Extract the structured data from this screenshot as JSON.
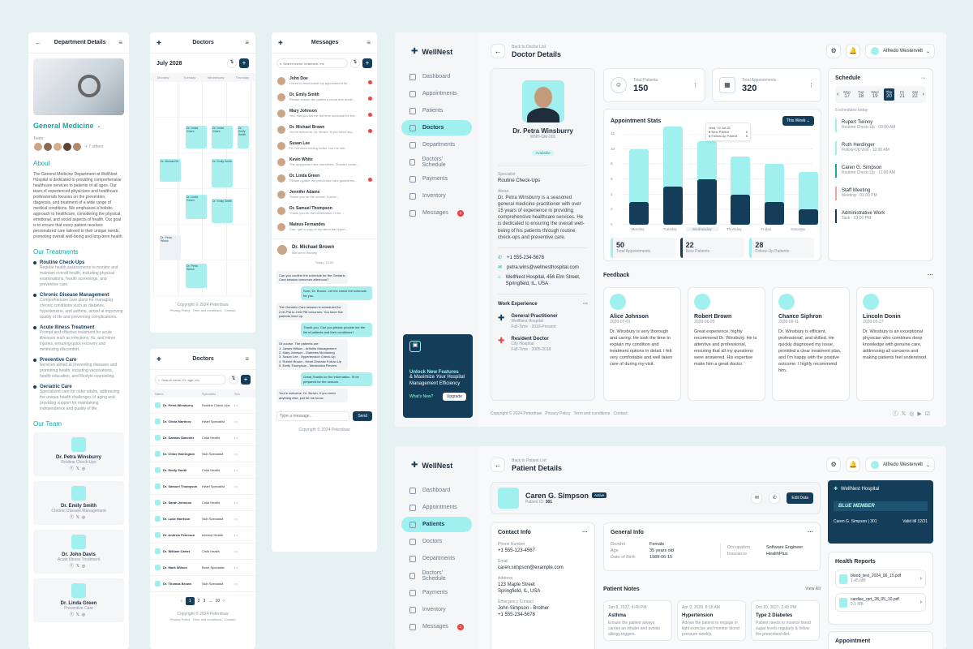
{
  "dept": {
    "title": "Department Details",
    "name": "General Medicine",
    "team_label": "Team",
    "others": "+ 7 others",
    "about_h": "About",
    "about": "The General Medicine Department at WellNest Hospital is dedicated to providing comprehensive healthcare services to patients of all ages. Our team of experienced physicians and healthcare professionals focuses on the prevention, diagnosis, and treatment of a wide range of medical conditions. We emphasize a holistic approach to healthcare, considering the physical, emotional, and social aspects of health. Our goal is to ensure that every patient receives personalized care tailored to their unique needs, promoting overall well-being and long-term health.",
    "treat_h": "Our Treatments",
    "treatments": [
      {
        "t": "Routine Check-Ups",
        "d": "Regular health assessments to monitor and maintain overall health, including physical examinations, health screenings, and preventive care."
      },
      {
        "t": "Chronic Disease Management",
        "d": "Comprehensive care plans for managing chronic conditions such as diabetes, hypertension, and asthma, aimed at improving quality of life and preventing complications."
      },
      {
        "t": "Acute Illness Treatment",
        "d": "Prompt and effective treatment for acute illnesses such as infections, flu, and minor injuries, ensuring quick recovery and minimizing discomfort."
      },
      {
        "t": "Preventive Care",
        "d": "Services aimed at preventing diseases and promoting health, including vaccinations, health education, and lifestyle counseling."
      },
      {
        "t": "Geriatric Care",
        "d": "Specialized care for older adults, addressing the unique health challenges of aging and providing support for maintaining independence and quality of life."
      }
    ],
    "team_h": "Our Team",
    "team": [
      {
        "n": "Dr. Petra Winsburry",
        "r": "Routine Check-Ups"
      },
      {
        "n": "Dr. Emily Smith",
        "r": "Chronic Disease Management"
      },
      {
        "n": "Dr. John Davis",
        "r": "Acute Illness Treatment"
      },
      {
        "n": "Dr. Linda Green",
        "r": "Preventive Care"
      }
    ]
  },
  "cal": {
    "title": "Doctors",
    "month": "July 2028",
    "days": [
      "Monday",
      "Tuesday",
      "Wednesday",
      "Thursday"
    ],
    "copy": "Copyright © 2024 Peterdraw",
    "links": [
      "Privacy Policy",
      "Term and conditions",
      "Contact"
    ],
    "events": [
      "Dr. Linda Green",
      "Dr. Linda Green",
      "Dr. Emily Smith",
      "Dr. Michael Br",
      "Dr. Emily Smith",
      "Dr. Linda Green",
      "Dr. Emily Smith",
      "Dr. Petra Winsb",
      "Dr. Petra Winsb"
    ]
  },
  "docs": {
    "title": "Doctors",
    "search": "Search name, ID, age, etc",
    "cols": [
      "Name",
      "Specialist",
      "Sch"
    ],
    "rows": [
      [
        "Dr. Petra Winsburry",
        "Routine Check-Ups"
      ],
      [
        "Dr. Olivia Martinez",
        "Heart Specialist"
      ],
      [
        "Dr. Damian Sanchez",
        "Child Health"
      ],
      [
        "Dr. Chloe Harrington",
        "Skin Specialist"
      ],
      [
        "Dr. Emily Smith",
        "Child Health"
      ],
      [
        "Dr. Samuel Thompson",
        "Heart Specialist"
      ],
      [
        "Dr. Sarah Johnson",
        "Child Health"
      ],
      [
        "Dr. Luke Harrison",
        "Skin Specialist"
      ],
      [
        "Dr. Andrew Peterson",
        "Internal Health"
      ],
      [
        "Dr. William Carter",
        "Child Health"
      ],
      [
        "Dr. Mark Wilson",
        "Bone Specialist"
      ],
      [
        "Dr. Thomas Brown",
        "Skin Specialist"
      ]
    ],
    "pages": [
      "1",
      "2",
      "3",
      "...",
      "10"
    ],
    "copy": "Copyright © 2024 Peterdraw",
    "links": [
      "Privacy Policy",
      "Term and conditions",
      "Contact"
    ]
  },
  "msg": {
    "title": "Messages",
    "search": "Search name, treatment, etc",
    "list": [
      {
        "n": "John Doe",
        "m": "I need to reschedule my appointment for..."
      },
      {
        "n": "Dr. Emily Smith",
        "m": "Please ensure the patient's blood test result..."
      },
      {
        "n": "Mary Johnson",
        "m": "Yes, can you tell me the time schedule for the..."
      },
      {
        "n": "Dr. Michael Brown",
        "m": "You're welcome, Dr. Brown. If you need any..."
      },
      {
        "n": "Susan Lee",
        "m": "Hi, I've been feeling better, but I've still..."
      },
      {
        "n": "Kevin White",
        "m": "The symptoms have worsened. Should I come..."
      },
      {
        "n": "Dr. Linda Green",
        "m": "Please update the preventive care guidelines..."
      },
      {
        "n": "Jennifer Adams",
        "m": "Thank you for the advice, Doctor..."
      },
      {
        "n": "Dr. Samuel Thompson",
        "m": "Thank you for the information. I'll be..."
      },
      {
        "n": "Mateus Fernandes",
        "m": "Can I get a copy of my latest lab report..."
      }
    ],
    "chat_with": "Dr. Michael Brown",
    "last_seen": "last seen recently",
    "today": "Today, 10:00",
    "bubbles": [
      "Can you confirm the schedule for the Geriatric Care session tomorrow afternoon?",
      "Sure, Dr. Brown. Let me check the schedule for you.",
      "The Geriatric Care session is scheduled for 2:00 PM to 4:00 PM tomorrow. You have five patients lined up.",
      "Thank you. Can you please provide me the list of patients and their conditions?",
      "Of course. The patients are:\n1. James Wilson - Arthritis Management\n2. Mary Johnson - Diabetes Monitoring\n3. Susan Lee - Hypertension Check-Up\n4. Robert Brown - Heart Disease Follow-Up\n5. Emily Thompson - Medication Review",
      "Great, thanks for the information. I'll be prepared for the session.",
      "You're welcome, Dr. Brown. If you need anything else, just let me know."
    ],
    "placeholder": "Type a message...",
    "send": "Send",
    "copy": "Copyright © 2024 Peterdraw"
  },
  "app": {
    "brand": "WellNest",
    "user": "Alfredo Westervelt",
    "nav": [
      "Dashboard",
      "Appointments",
      "Patients",
      "Doctors",
      "Departments",
      "Doctors' Schedule",
      "Payments",
      "Inventory",
      "Messages"
    ],
    "msg_badge": "2",
    "promo_title": "Unlock New Features",
    "promo_text": "& Maximize Your Hospital Management Efficiency",
    "promo_link": "What's New?",
    "promo_btn": "Upgrade"
  },
  "doctor": {
    "back": "Back to Doctor List",
    "title": "Doctor Details",
    "name": "Dr. Petra Winsburry",
    "id": "WNH-GM-001",
    "status": "Available",
    "spec_l": "Specialist",
    "spec": "Routine Check-Ups",
    "about_l": "About",
    "about": "Dr. Petra Winsburry is a seasoned general medicine practitioner with over 15 years of experience in providing comprehensive healthcare services. He is dedicated to ensuring the overall well-being of his patients through routine check-ups and preventive care.",
    "phone": "+1 555-234-5678",
    "email": "petra.wins@wellnesthospital.com",
    "addr": "WellNest Hospital, 456 Elm Street, Springfield, IL, USA",
    "work_h": "Work Experience",
    "work": [
      {
        "t": "General Practitioner",
        "p": "WellNest Hospital",
        "y": "Full-Time  ·  2018-Present"
      },
      {
        "t": "Resident Doctor",
        "p": "City Hospital",
        "y": "Full-Time  ·  2005-2018"
      }
    ],
    "tp_l": "Total Patients",
    "tp": "150",
    "ta_l": "Total Appointments",
    "ta": "320",
    "stats_h": "Appointment Stats",
    "filter": "This Week",
    "tip_date": "Wed, 10 Jul 28",
    "tip_new": "New Patient",
    "tip_new_v": "6",
    "tip_fu": "Follow-Up Patient",
    "tip_fu_v": "5",
    "sum": [
      {
        "v": "50",
        "l": "Total Appointments"
      },
      {
        "v": "22",
        "l": "New Patients"
      },
      {
        "v": "28",
        "l": "Follow-Up Patients"
      }
    ],
    "fb_h": "Feedback",
    "feedback": [
      {
        "n": "Alice Johnson",
        "d": "2028-07-01",
        "t": "Dr. Winsbury is very thorough and caring. He took the time to explain my condition and treatment options in detail. I felt very comfortable and well taken care of during my visit."
      },
      {
        "n": "Robert Brown",
        "d": "2028-06-25",
        "t": "Great experience, highly recommend Dr. Winsbury. He is attentive and professional, ensuring that all my questions were answered. His expertise make him a great doctor."
      },
      {
        "n": "Chance Siphron",
        "d": "2028-06-11",
        "t": "Dr. Winsbury is efficient, professional, and skilled. He quickly diagnosed my issue, provided a clear treatment plan, and I'm happy with the positive outcome. I highly recommend him."
      },
      {
        "n": "Lincoln Donin",
        "d": "2028-05-27",
        "t": "Dr. Winsbury is an exceptional physician who combines deep knowledge with genuine care, addressing all concerns and making patients feel understood."
      }
    ],
    "sched_h": "Schedule",
    "sched_count": "5 schedules today",
    "week": [
      {
        "d": "Mon",
        "n": "17"
      },
      {
        "d": "Tue",
        "n": "18"
      },
      {
        "d": "Wed",
        "n": "19"
      },
      {
        "d": "Thu",
        "n": "20"
      },
      {
        "d": "Fri",
        "n": "21"
      },
      {
        "d": "Sat",
        "n": "22"
      }
    ],
    "sched": [
      {
        "n": "Rupert Twinny",
        "t": "Routine Check-Up  ·  09:00 AM"
      },
      {
        "n": "Ruth Herdinger",
        "t": "Follow-Up Visit  ·  10:00 AM"
      },
      {
        "n": "Caren G. Simpson",
        "t": "Routine Check-Up  ·  11:00 AM"
      },
      {
        "n": "Staff Meeting",
        "t": "Meeting  ·  01:00 PM"
      },
      {
        "n": "Administrative Work",
        "t": "Task  ·  03:00 PM"
      }
    ],
    "copy": "Copyright © 2024 Peterdraw",
    "links": [
      "Privacy Policy",
      "Term and conditions",
      "Contact"
    ]
  },
  "chart_data": {
    "type": "bar",
    "categories": [
      "Monday",
      "Tuesday",
      "Wednesday",
      "Thursday",
      "Friday",
      "Saturday"
    ],
    "series": [
      {
        "name": "New Patient",
        "values": [
          3,
          5,
          6,
          4,
          3,
          2
        ]
      },
      {
        "name": "Follow-Up Patient",
        "values": [
          7,
          8,
          5,
          5,
          5,
          5
        ]
      }
    ],
    "ylim": [
      0,
      12
    ],
    "yticks": [
      "12",
      "10",
      "8",
      "6",
      "4",
      "2",
      "0"
    ]
  },
  "patient": {
    "back": "Back to Patient List",
    "title": "Patient Details",
    "name": "Caren G. Simpson",
    "status": "Active",
    "pid_l": "Patient ID:",
    "pid": "301",
    "edit": "Edit Data",
    "contact_h": "Contact Info",
    "phone_l": "Phone Number",
    "phone": "+1 555-123-4567",
    "email_l": "Email",
    "email": "caren.simpson@example.com",
    "addr_l": "Address",
    "addr": "123 Maple Street\nSpringfield, IL, USA",
    "em_l": "Emergency Contact",
    "em": "John Simpson - Brother\n+1 555-234-5678",
    "gen_h": "General Info",
    "gen": [
      [
        "Gender",
        "Female"
      ],
      [
        "Age",
        "35 years old"
      ],
      [
        "Date of Birth",
        "1989-06-15"
      ]
    ],
    "gen2": [
      [
        "Occupation",
        "Software Engineer"
      ],
      [
        "Insurance",
        "HealthPlus"
      ]
    ],
    "notes_h": "Patient Notes",
    "view_all": "View All",
    "notes": [
      {
        "d": "Jun 8, 2027, 4:45 PM",
        "t": "Asthma",
        "x": "Ensure the patient always carries an inhaler and avoids allergy triggers."
      },
      {
        "d": "Apr 9, 2028, 8:15 AM",
        "t": "Hypertension",
        "x": "Advise the patient to engage in light exercise and monitor blood-pressure weekly."
      },
      {
        "d": "Oct 10, 2027, 2:45 PM",
        "t": "Type 2 Diabetes",
        "x": "Patient needs to monitor blood sugar levels regularly & follow the prescribed diet."
      }
    ],
    "card_brand": "WellNest Hospital",
    "member": "BLUE MEMBER",
    "card_name": "Caren G. Simpson",
    "card_id": "301",
    "valid": "Valid till 12/31",
    "reports_h": "Health Reports",
    "reports": [
      {
        "f": "blood_test_2024_06_15.pdf",
        "s": "1.45 MB"
      },
      {
        "f": "cardiac_rprt_28_05_10.pdf",
        "s": "2.1 MB"
      }
    ],
    "appt_h": "Appointment"
  }
}
